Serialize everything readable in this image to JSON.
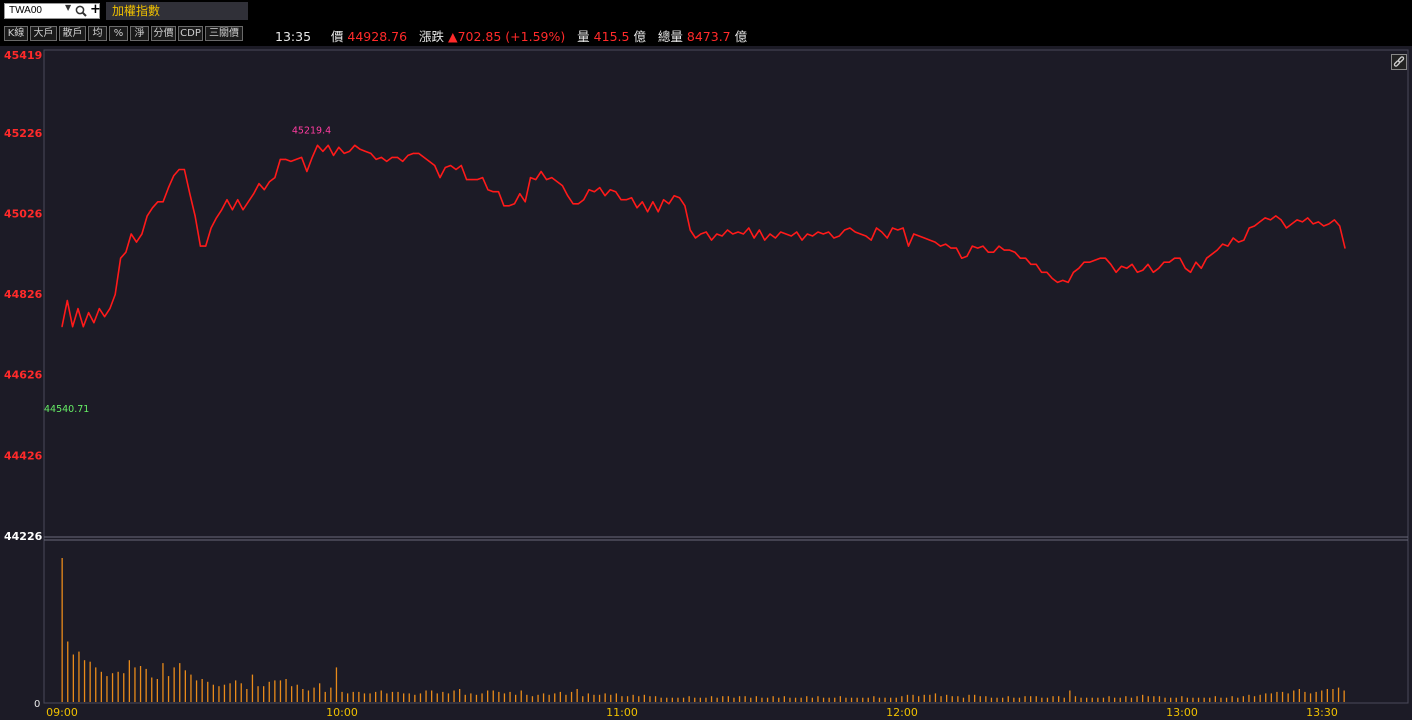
{
  "header": {
    "symbol": "TWA00",
    "index_name": "加權指數"
  },
  "toolbar": {
    "buttons": [
      "K線",
      "大戶",
      "散戶",
      "均",
      "%",
      "淨",
      "分價",
      "CDP",
      "三關價"
    ]
  },
  "quote": {
    "time": "13:35",
    "price_label": "價",
    "price": "44928.76",
    "change_label": "漲跌",
    "change": "▲702.85 (+1.59%)",
    "volume_label": "量",
    "volume": "415.5",
    "volume_unit": "億",
    "total_volume_label": "總量",
    "total_volume": "8473.7",
    "total_volume_unit": "億"
  },
  "colors": {
    "background": "#1c1b26",
    "price_line": "#ff1a1a",
    "volume_bar": "#e88a1a",
    "axis_price": "#ff2a2a",
    "axis_time": "#f0c000",
    "high_marker": "#ff3ca0",
    "low_marker": "#66ee66"
  },
  "chart_data": [
    {
      "type": "line",
      "series": [
        {
          "values": [
            44745,
            44810,
            44745,
            44790,
            44745,
            44780,
            44755,
            44790,
            44770,
            44790,
            44825,
            44915,
            44930,
            44975,
            44955,
            44975,
            45020,
            45040,
            45055,
            45055,
            45090,
            45120,
            45135,
            45135,
            45075,
            45020,
            44945,
            44945,
            44990,
            45015,
            45035,
            45060,
            45035,
            45060,
            45035,
            45055,
            45075,
            45100,
            45085,
            45105,
            45115,
            45160,
            45160,
            45155,
            45160,
            45165,
            45130,
            45165,
            45195,
            45180,
            45195,
            45170,
            45190,
            45175,
            45180,
            45195,
            45185,
            45180,
            45175,
            45160,
            45165,
            45155,
            45165,
            45165,
            45155,
            45170,
            45175,
            45175,
            45165,
            45155,
            45145,
            45115,
            45140,
            45145,
            45135,
            45145,
            45110,
            45110,
            45110,
            45115,
            45085,
            45080,
            45080,
            45045,
            45045,
            45050,
            45075,
            45055,
            45115,
            45110,
            45130,
            45110,
            45115,
            45105,
            45095,
            45070,
            45050,
            45050,
            45060,
            45085,
            45080,
            45090,
            45070,
            45085,
            45080,
            45060,
            45060,
            45065,
            45040,
            45055,
            45030,
            45055,
            45030,
            45060,
            45050,
            45070,
            45065,
            45045,
            44985,
            44965,
            44975,
            44980,
            44960,
            44975,
            44970,
            44985,
            44975,
            44980,
            44975,
            44990,
            44965,
            44985,
            44960,
            44975,
            44965,
            44980,
            44975,
            44970,
            44980,
            44960,
            44975,
            44970,
            44980,
            44975,
            44980,
            44965,
            44970,
            44985,
            44990,
            44980,
            44975,
            44970,
            44960,
            44990,
            44980,
            44965,
            44990,
            44985,
            44990,
            44945,
            44975,
            44970,
            44965,
            44960,
            44955,
            44945,
            44950,
            44940,
            44940,
            44915,
            44920,
            44945,
            44940,
            44945,
            44930,
            44930,
            44945,
            44935,
            44935,
            44930,
            44915,
            44915,
            44900,
            44900,
            44880,
            44880,
            44865,
            44855,
            44860,
            44855,
            44880,
            44890,
            44905,
            44905,
            44910,
            44915,
            44915,
            44900,
            44880,
            44895,
            44890,
            44900,
            44880,
            44885,
            44900,
            44880,
            44890,
            44905,
            44905,
            44915,
            44915,
            44890,
            44880,
            44905,
            44890,
            44915,
            44925,
            44935,
            44950,
            44945,
            44965,
            44955,
            44960,
            44990,
            44995,
            45005,
            45015,
            45010,
            45020,
            45010,
            44990,
            45000,
            45010,
            45005,
            45015,
            45000,
            45005,
            44995,
            45000,
            45010,
            44995,
            44940
          ],
          "high_label": "45219.4",
          "low_label": "44540.71"
        }
      ],
      "x_tick_labels": [
        "09:00",
        "10:00",
        "11:00",
        "12:00",
        "13:00",
        "13:30"
      ],
      "y_tick_labels": [
        "45419",
        "45226",
        "45026",
        "44826",
        "44626",
        "44426",
        "44226"
      ],
      "ylim": [
        44226,
        45419
      ]
    },
    {
      "type": "bar",
      "y_tick_labels": [
        "0"
      ],
      "values": [
        100,
        42,
        33,
        35,
        29,
        28,
        24,
        21,
        18,
        20,
        21,
        20,
        29,
        24,
        25,
        23,
        17,
        16,
        27,
        18,
        24,
        27,
        22,
        19,
        15,
        16,
        14,
        12,
        11,
        12,
        13,
        15,
        13,
        9,
        19,
        11,
        11,
        14,
        15,
        15,
        16,
        11,
        12,
        9,
        8,
        10,
        13,
        7,
        10,
        24,
        7,
        6,
        7,
        7,
        6,
        6,
        7,
        8,
        6,
        7,
        7,
        6,
        6,
        5,
        6,
        8,
        8,
        6,
        7,
        6,
        8,
        9,
        5,
        6,
        5,
        6,
        8,
        8,
        7,
        6,
        7,
        5,
        8,
        5,
        4,
        5,
        6,
        5,
        6,
        7,
        5,
        7,
        9,
        4,
        6,
        5,
        5,
        6,
        5,
        6,
        4,
        4,
        5,
        4,
        5,
        4,
        4,
        3,
        3,
        3,
        3,
        3,
        4,
        3,
        3,
        3,
        4,
        3,
        4,
        4,
        3,
        4,
        4,
        3,
        4,
        3,
        3,
        4,
        3,
        4,
        3,
        3,
        3,
        4,
        3,
        4,
        3,
        3,
        3,
        4,
        3,
        3,
        3,
        3,
        3,
        4,
        3,
        3,
        3,
        3,
        4,
        5,
        5,
        4,
        5,
        5,
        6,
        4,
        5,
        4,
        4,
        3,
        5,
        5,
        4,
        4,
        3,
        3,
        3,
        4,
        3,
        3,
        4,
        4,
        4,
        3,
        3,
        4,
        4,
        3,
        8,
        4,
        3,
        3,
        3,
        3,
        3,
        4,
        3,
        3,
        4,
        3,
        4,
        5,
        4,
        4,
        4,
        3,
        3,
        3,
        4,
        3,
        3,
        3,
        3,
        3,
        4,
        3,
        3,
        4,
        3,
        4,
        5,
        4,
        5,
        6,
        6,
        7,
        7,
        6,
        8,
        9,
        7,
        6,
        7,
        8,
        9,
        9,
        10,
        8
      ]
    }
  ]
}
